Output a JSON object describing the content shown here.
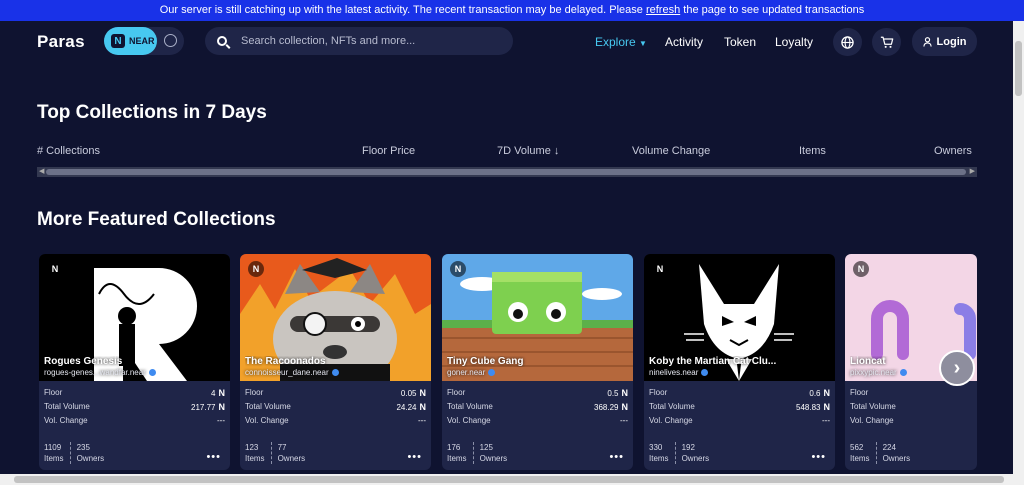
{
  "banner": {
    "text_before": "Our server is still catching up with the latest activity. The recent transaction may be delayed. Please ",
    "link": "refresh",
    "text_after": " the page to see updated transactions"
  },
  "nav": {
    "logo": "Paras",
    "near_label": "NEAR",
    "search_placeholder": "Search collection, NFTs and more...",
    "menu": [
      "Explore",
      "Activity",
      "Token",
      "Loyalty"
    ],
    "login": "Login",
    "icons": [
      "globe-icon",
      "cart-icon",
      "user-icon"
    ]
  },
  "top": {
    "title": "Top Collections in 7 Days",
    "columns": [
      "# Collections",
      "Floor Price",
      "7D Volume ↓",
      "Volume Change",
      "Items",
      "Owners"
    ]
  },
  "featured": {
    "title": "More Featured Collections",
    "labels": {
      "floor": "Floor",
      "volume": "Total Volume",
      "change": "Vol. Change",
      "items": "Items",
      "owners": "Owners"
    },
    "cards": [
      {
        "name": "Rogues Genesis",
        "owner": "rogues-genes...wandfar.near",
        "floor": "4",
        "volume": "217.77",
        "change": "---",
        "items": "1109",
        "owners": "235"
      },
      {
        "name": "The Racoonados",
        "owner": "connoisseur_dane.near",
        "floor": "0.05",
        "volume": "24.24",
        "change": "---",
        "items": "123",
        "owners": "77"
      },
      {
        "name": "Tiny Cube Gang",
        "owner": "goner.near",
        "floor": "0.5",
        "volume": "368.29",
        "change": "---",
        "items": "176",
        "owners": "125"
      },
      {
        "name": "Koby the Martian Cat Clu...",
        "owner": "ninelives.near",
        "floor": "0.6",
        "volume": "548.83",
        "change": "---",
        "items": "330",
        "owners": "192"
      },
      {
        "name": "Lioncat",
        "owner": "pixxypic.near",
        "floor": "",
        "volume": "",
        "change": "---",
        "items": "562",
        "owners": "224"
      }
    ]
  },
  "colors": {
    "background": "#0f1330",
    "card": "#1f2548",
    "accent": "#47c8f0",
    "banner": "#1932e8"
  }
}
